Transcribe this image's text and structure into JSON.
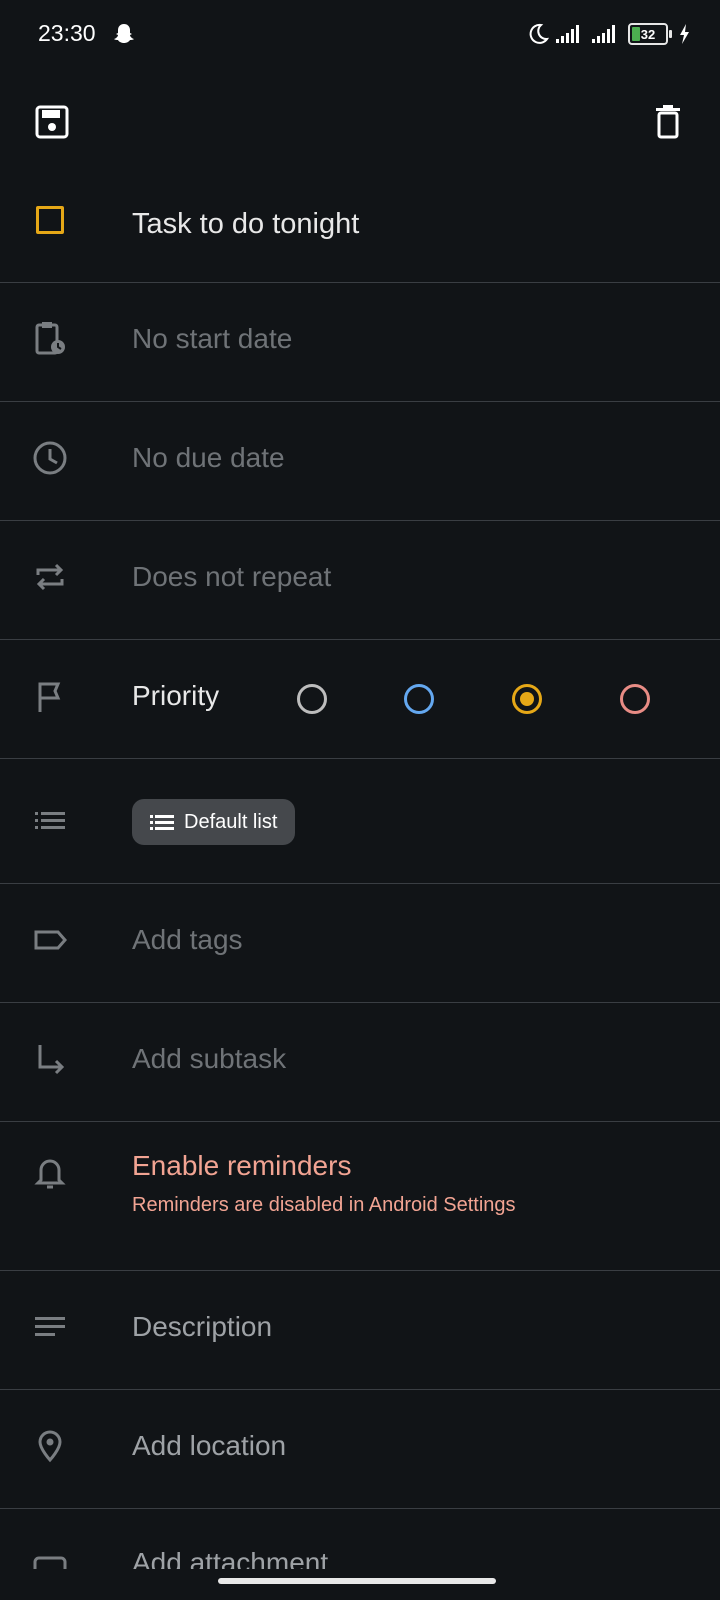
{
  "status": {
    "time": "23:30",
    "battery": "32"
  },
  "task": {
    "title": "Task to do tonight",
    "start_date": "No start date",
    "due_date": "No due date",
    "repeat": "Does not repeat",
    "priority_label": "Priority",
    "priority_options": [
      "none",
      "low",
      "medium",
      "high"
    ],
    "priority_selected": "medium",
    "list_chip": "Default list",
    "tags": "Add tags",
    "subtask": "Add subtask",
    "reminders_title": "Enable reminders",
    "reminders_sub": "Reminders are disabled in Android Settings",
    "description": "Description",
    "location": "Add location",
    "attachment": "Add attachment"
  },
  "colors": {
    "checkbox": "#E6A817",
    "priority_none": "#BDBDBD",
    "priority_low": "#64A8F0",
    "priority_medium": "#E6A817",
    "priority_high": "#E88C85",
    "warning": "#F2A493"
  }
}
